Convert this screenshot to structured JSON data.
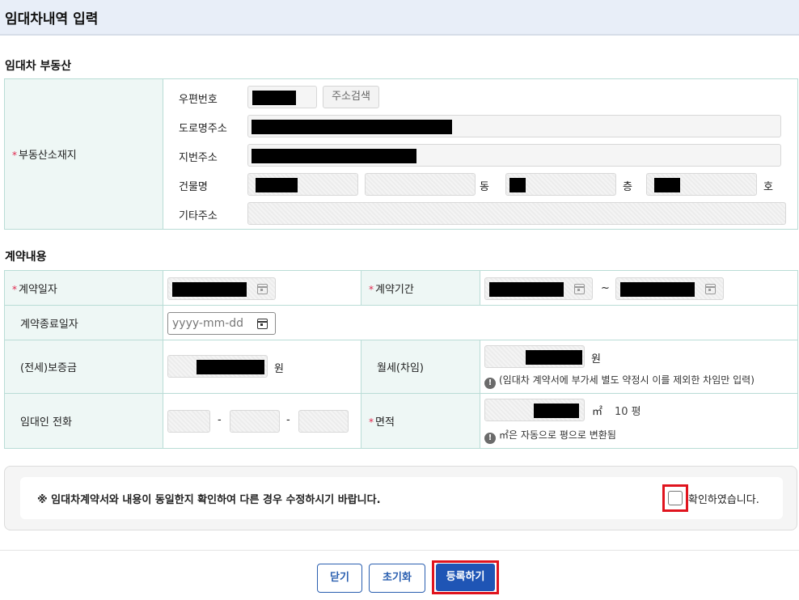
{
  "page_title": "임대차내역 입력",
  "property": {
    "section_title": "임대차 부동산",
    "location_label": "부동산소재지",
    "required_mark": "*",
    "postal_label": "우편번호",
    "address_search_button": "주소검색",
    "road_address_label": "도로명주소",
    "lot_address_label": "지번주소",
    "building_label": "건물명",
    "dong_unit": "동",
    "floor_unit": "층",
    "ho_unit": "호",
    "other_address_label": "기타주소"
  },
  "contract": {
    "section_title": "계약내용",
    "contract_date_label": "계약일자",
    "contract_period_label": "계약기간",
    "period_separator": "~",
    "end_date_label": "계약종료일자",
    "end_date_placeholder": "yyyy-mm-dd",
    "deposit_label": "(전세)보증금",
    "deposit_unit": "원",
    "monthly_rent_label": "월세(차임)",
    "monthly_rent_unit": "원",
    "monthly_rent_note": "(임대차 계약서에 부가세 별도 약정시 이를 제외한 차임만 입력)",
    "landlord_phone_label": "임대인 전화",
    "phone_separator": "-",
    "area_label": "면적",
    "area_unit": "㎡",
    "pyeong_value": "10 평",
    "area_note": "㎡은 자동으로 평으로 변환됨"
  },
  "confirm": {
    "notice": "※ 임대차계약서와 내용이 동일한지 확인하여 다른 경우 수정하시기 바랍니다.",
    "checkbox_label": "확인하였습니다."
  },
  "buttons": {
    "close": "닫기",
    "reset": "초기화",
    "submit": "등록하기"
  },
  "colors": {
    "required": "#e0264d",
    "primary": "#1f55b5",
    "highlight": "#e0141e",
    "label_bg": "#eef7f5"
  }
}
